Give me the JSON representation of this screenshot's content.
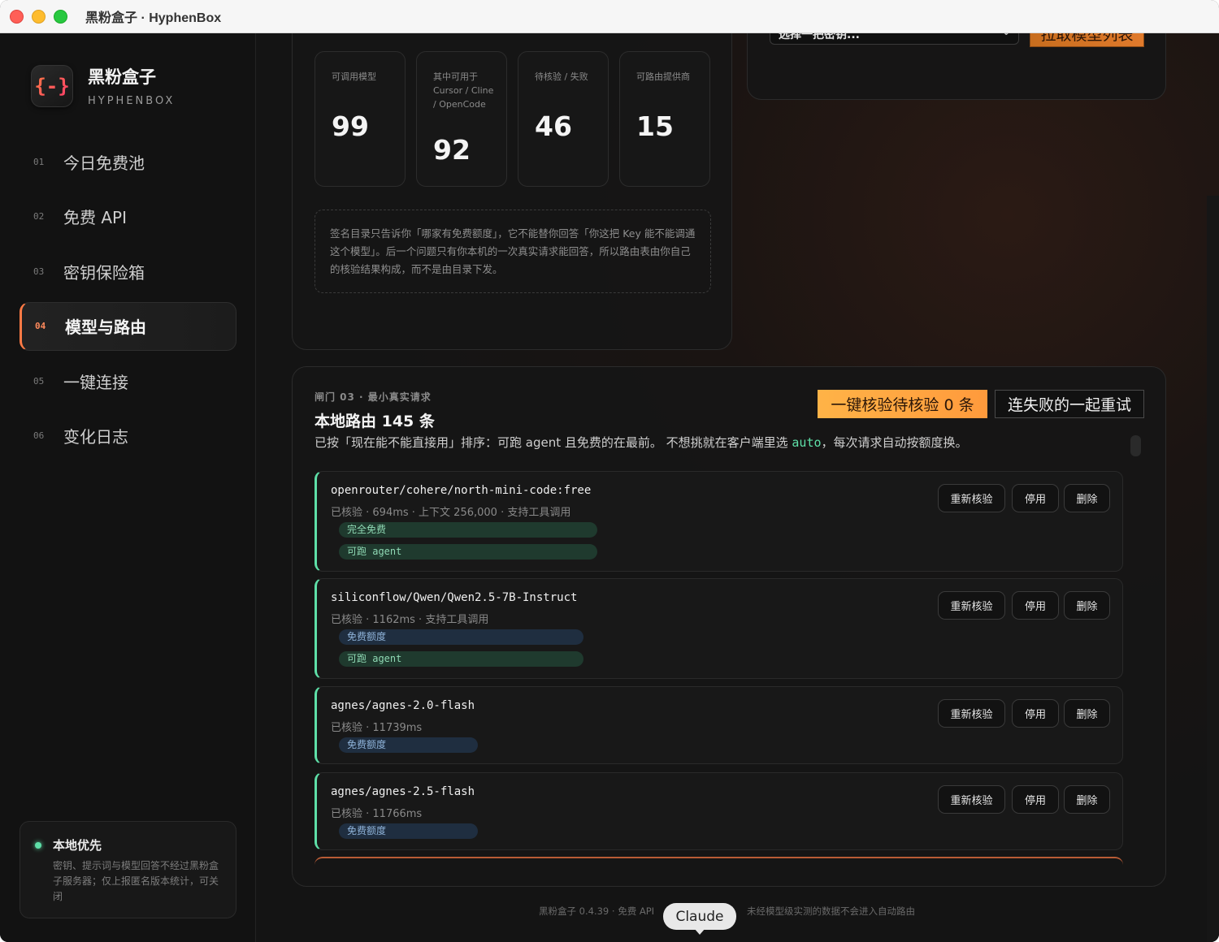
{
  "window": {
    "title": "黑粉盒子 · HyphenBox"
  },
  "brand": {
    "name": "黑粉盒子",
    "sub": "HYPHENBOX",
    "logo_glyph": "{-}"
  },
  "nav": [
    {
      "num": "01",
      "label": "今日免费池"
    },
    {
      "num": "02",
      "label": "免费 API"
    },
    {
      "num": "03",
      "label": "密钥保险箱"
    },
    {
      "num": "04",
      "label": "模型与路由",
      "active": true
    },
    {
      "num": "05",
      "label": "一键连接"
    },
    {
      "num": "06",
      "label": "变化日志"
    }
  ],
  "local": {
    "title": "本地优先",
    "desc": "密钥、提示词与模型回答不经过黑粉盒子服务器；仅上报匿名版本统计，可关闭"
  },
  "stats": [
    {
      "label": "可调用模型",
      "value": "99"
    },
    {
      "label": "其中可用于 Cursor / Cline / OpenCode",
      "value": "92"
    },
    {
      "label": "待核验 / 失败",
      "value": "46"
    },
    {
      "label": "可路由提供商",
      "value": "15"
    }
  ],
  "note": "签名目录只告诉你「哪家有免费额度」，它不能替你回答「你这把 Key 能不能调通这个模型」。后一个问题只有你本机的一次真实请求能回答，所以路由表由你自己的核验结果构成，而不是由目录下发。",
  "key_picker": {
    "placeholder": "选择一把密钥...",
    "pull_label": "拉取模型列表"
  },
  "routes": {
    "gate": "闸门 03 · 最小真实请求",
    "title": "本地路由 145 条",
    "desc_prefix": "已按「现在能不能直接用」排序：可跑 agent 且免费的在最前。 不想挑就在客户端里选 ",
    "desc_code": "auto",
    "desc_suffix": "，每次请求自动按额度换。",
    "verify_label": "一键核验待核验 0 条",
    "retry_label": "连失败的一起重试",
    "btn_reverify": "重新核验",
    "btn_disable": "停用",
    "btn_delete": "删除",
    "items": [
      {
        "name": "openrouter/cohere/north-mini-code:free",
        "meta": "已核验 · 694ms · 上下文 256,000 · 支持工具调用",
        "tags": [
          "完全免费",
          "可跑 agent"
        ]
      },
      {
        "name": "siliconflow/Qwen/Qwen2.5-7B-Instruct",
        "meta": "已核验 · 1162ms · 支持工具调用",
        "tags": [
          "免费额度",
          "可跑 agent"
        ]
      },
      {
        "name": "agnes/agnes-2.0-flash",
        "meta": "已核验 · 11739ms",
        "tags": [
          "免费额度"
        ]
      },
      {
        "name": "agnes/agnes-2.5-flash",
        "meta": "已核验 · 11766ms",
        "tags": [
          "免费额度"
        ]
      }
    ]
  },
  "footer": {
    "left": "黑粉盒子 0.4.39 · 免费 API",
    "right": "未经模型级实测的数据不会进入自动路由"
  },
  "tooltip": "Claude",
  "colors": {
    "accent": "#ff7a45",
    "ok": "#5ee0a8",
    "button_warm": "#ffb347"
  }
}
